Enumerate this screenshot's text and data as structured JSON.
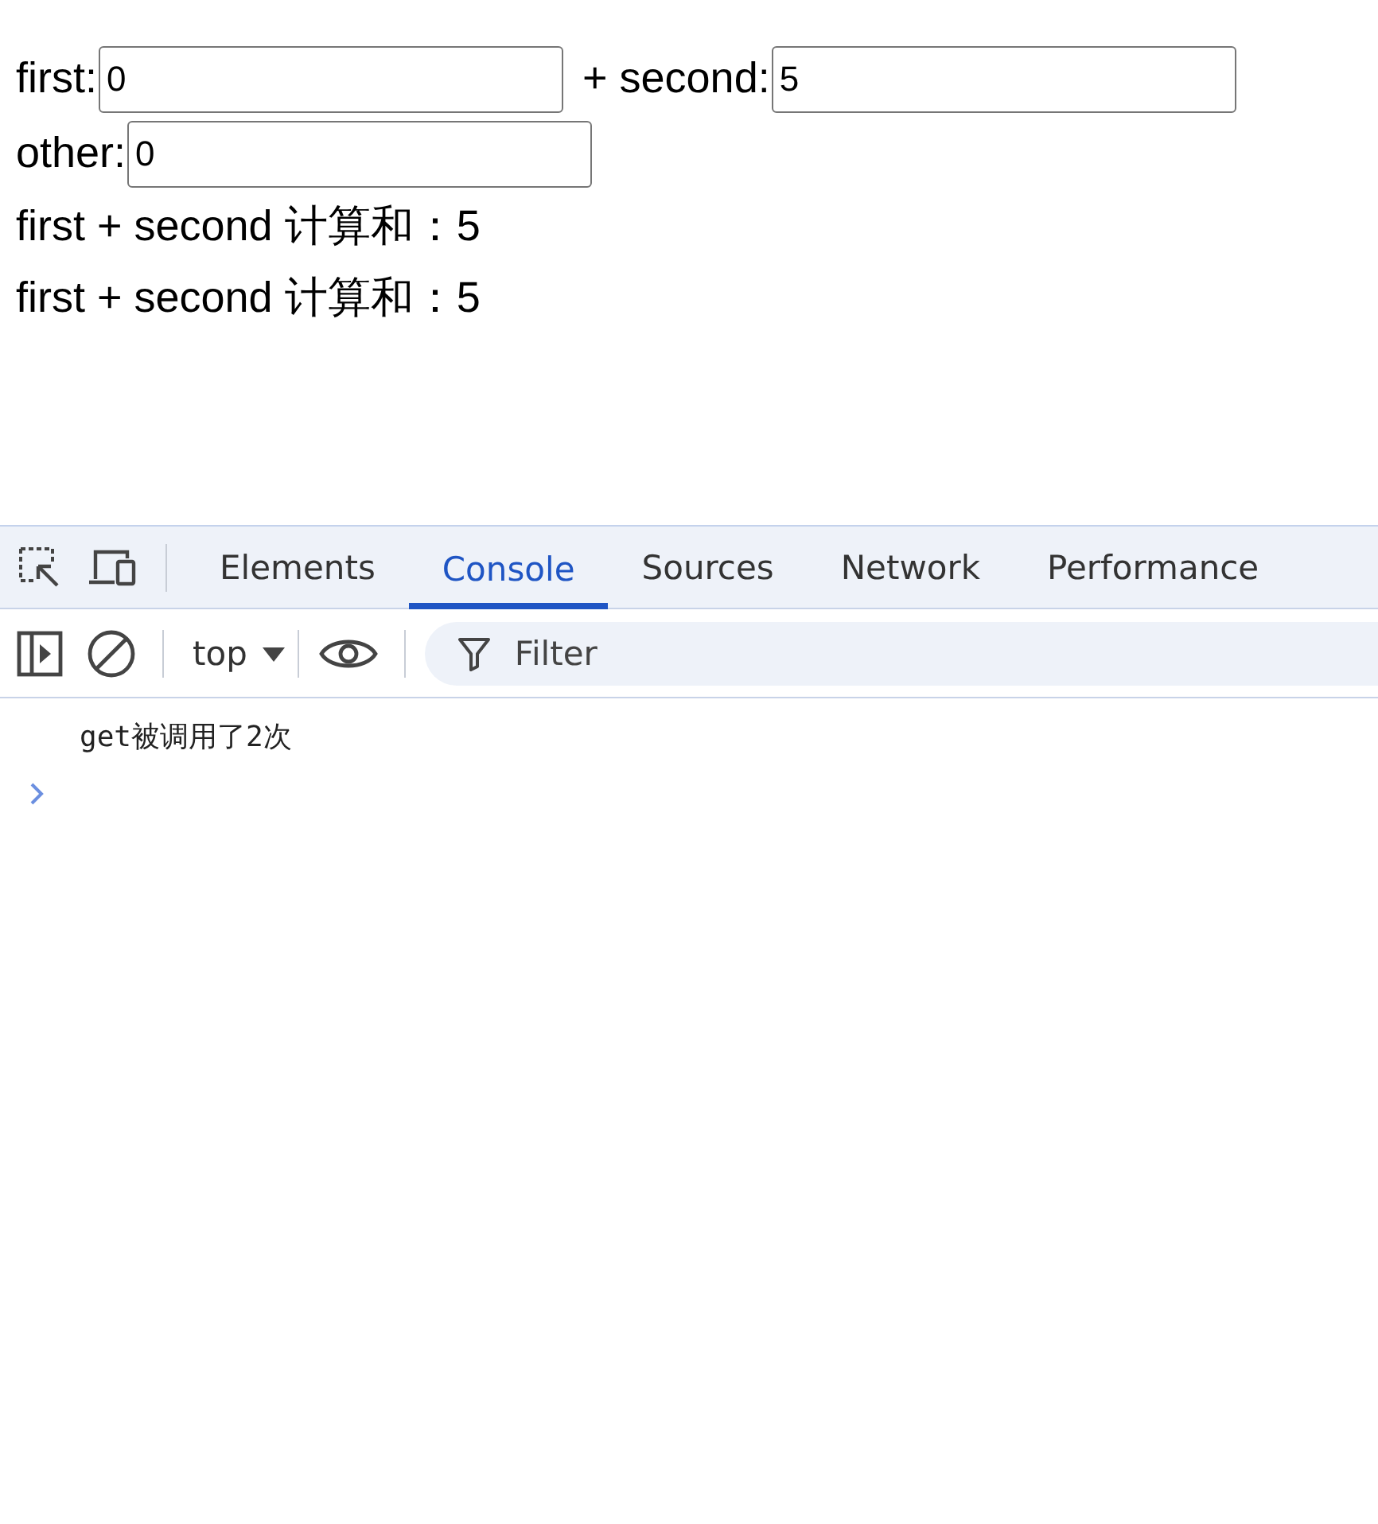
{
  "page": {
    "rows": [
      {
        "items": [
          {
            "kind": "label",
            "text": "first:"
          },
          {
            "kind": "input",
            "value": "0"
          },
          {
            "kind": "label",
            "text": "+ second:"
          },
          {
            "kind": "input",
            "value": "5"
          }
        ]
      },
      {
        "items": [
          {
            "kind": "label",
            "text": "other:"
          },
          {
            "kind": "input",
            "value": "0"
          }
        ]
      }
    ],
    "results": [
      "first + second 计算和：5",
      "first + second 计算和：5"
    ]
  },
  "devtools": {
    "tabs": [
      {
        "label": "Elements",
        "selected": false
      },
      {
        "label": "Console",
        "selected": true
      },
      {
        "label": "Sources",
        "selected": false
      },
      {
        "label": "Network",
        "selected": false
      },
      {
        "label": "Performance",
        "selected": false
      }
    ],
    "toolbar": {
      "context": "top",
      "filter": {
        "placeholder": "Filter"
      }
    },
    "console": {
      "messages": [
        "get被调用了2次"
      ]
    }
  }
}
